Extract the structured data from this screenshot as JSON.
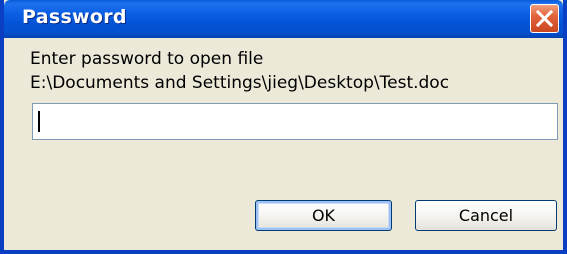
{
  "window": {
    "title": "Password"
  },
  "titlebar": {
    "close_icon": "close-icon"
  },
  "dialog": {
    "prompt": "Enter password to open file",
    "file_path": "E:\\Documents and Settings\\jieg\\Desktop\\Test.doc",
    "password_value": "",
    "ok_label": "OK",
    "cancel_label": "Cancel"
  },
  "colors": {
    "titlebar": "#0554d7",
    "window_border": "#0a3fc4",
    "client_bg": "#ece9d8",
    "close_button": "#e2643c"
  }
}
